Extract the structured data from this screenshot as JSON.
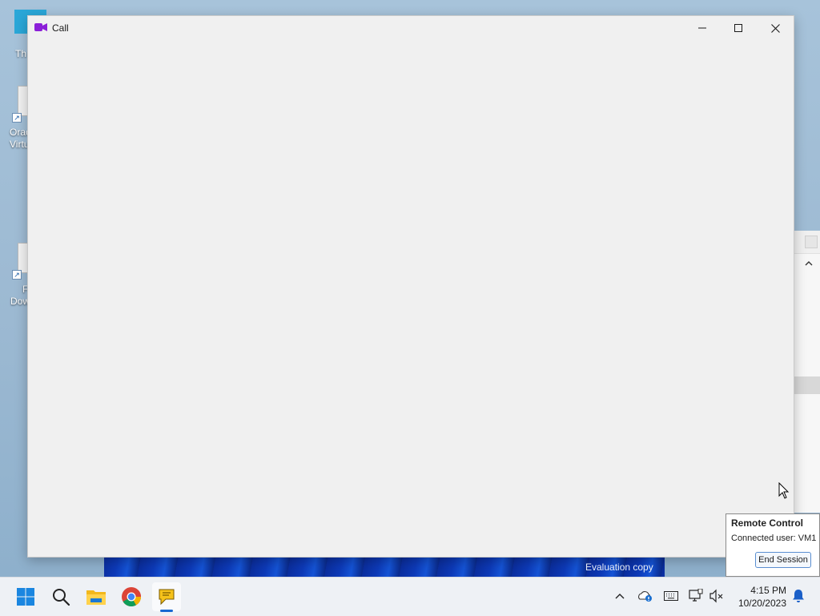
{
  "desktop": {
    "icons": [
      {
        "label_line1": "Th",
        "label_line2": ""
      },
      {
        "label_line1": "Orac",
        "label_line2": "Virtu"
      },
      {
        "label_line1": "F",
        "label_line2": "Dow"
      }
    ],
    "watermark": "Evaluation copy"
  },
  "call_window": {
    "title": "Call",
    "icon": "video-camera-icon",
    "accent_color": "#8b1fd8",
    "controls": {
      "minimize": "minimize-icon",
      "maximize": "maximize-icon",
      "close": "close-icon"
    }
  },
  "remote_control": {
    "title": "Remote Control",
    "connected_user": "Connected user: VM1",
    "end_session_label": "End Session"
  },
  "taskbar": {
    "apps": [
      "start-icon",
      "search-icon",
      "file-explorer-icon",
      "chrome-icon",
      "chat-app-icon"
    ],
    "active_app": "chat-app-icon",
    "tray": [
      "chevron-up-icon",
      "onedrive-icon",
      "keyboard-icon",
      "network-icon",
      "volume-muted-icon"
    ],
    "time": "4:15 PM",
    "date": "10/20/2023",
    "notification_icon": "bell-icon"
  }
}
